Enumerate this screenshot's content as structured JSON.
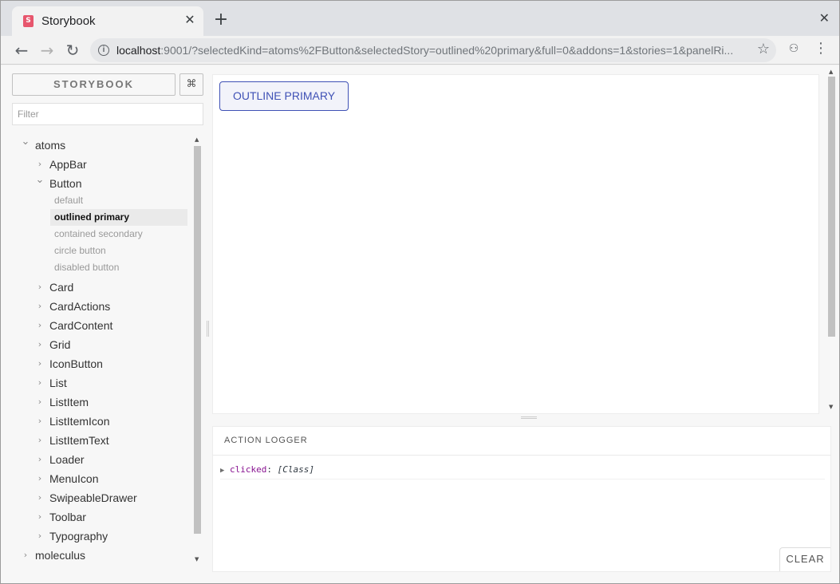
{
  "browser": {
    "tab_title": "Storybook",
    "favicon_letter": "S",
    "url_host": "localhost",
    "url_rest": ":9001/?selectedKind=atoms%2FButton&selectedStory=outlined%20primary&full=0&addons=1&stories=1&panelRi..."
  },
  "sidebar": {
    "header": "STORYBOOK",
    "shortcut_label": "⌘",
    "filter_placeholder": "Filter",
    "tree": [
      {
        "label": "atoms",
        "depth": 0,
        "expanded": true
      },
      {
        "label": "AppBar",
        "depth": 1,
        "expanded": false
      },
      {
        "label": "Button",
        "depth": 1,
        "expanded": true
      },
      {
        "label": "Card",
        "depth": 1,
        "expanded": false
      },
      {
        "label": "CardActions",
        "depth": 1,
        "expanded": false
      },
      {
        "label": "CardContent",
        "depth": 1,
        "expanded": false
      },
      {
        "label": "Grid",
        "depth": 1,
        "expanded": false
      },
      {
        "label": "IconButton",
        "depth": 1,
        "expanded": false
      },
      {
        "label": "List",
        "depth": 1,
        "expanded": false
      },
      {
        "label": "ListItem",
        "depth": 1,
        "expanded": false
      },
      {
        "label": "ListItemIcon",
        "depth": 1,
        "expanded": false
      },
      {
        "label": "ListItemText",
        "depth": 1,
        "expanded": false
      },
      {
        "label": "Loader",
        "depth": 1,
        "expanded": false
      },
      {
        "label": "MenuIcon",
        "depth": 1,
        "expanded": false
      },
      {
        "label": "SwipeableDrawer",
        "depth": 1,
        "expanded": false
      },
      {
        "label": "Toolbar",
        "depth": 1,
        "expanded": false
      },
      {
        "label": "Typography",
        "depth": 1,
        "expanded": false
      },
      {
        "label": "moleculus",
        "depth": 0,
        "expanded": false
      }
    ],
    "stories": [
      {
        "label": "default",
        "selected": false
      },
      {
        "label": "outlined primary",
        "selected": true
      },
      {
        "label": "contained secondary",
        "selected": false
      },
      {
        "label": "circle button",
        "selected": false
      },
      {
        "label": "disabled button",
        "selected": false
      }
    ]
  },
  "preview": {
    "button_label": "OUTLINE PRIMARY",
    "accent_color": "#3f51b5"
  },
  "panel": {
    "tab_label": "ACTION LOGGER",
    "log_key": "clicked",
    "log_value": "[Class]",
    "clear_label": "CLEAR"
  }
}
